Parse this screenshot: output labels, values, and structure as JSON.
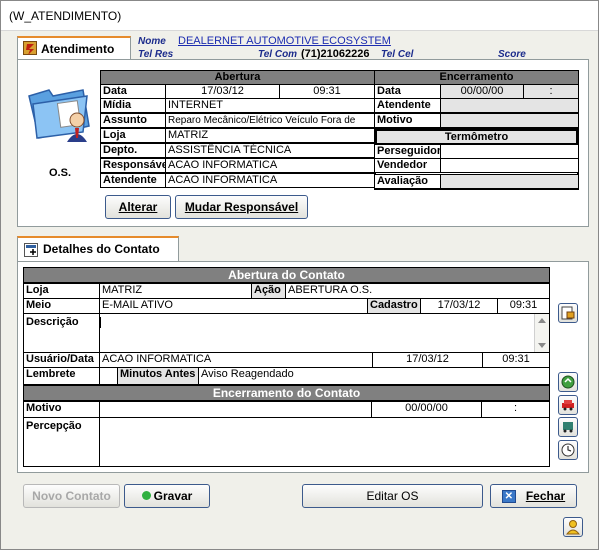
{
  "window": {
    "title": "(W_ATENDIMENTO)"
  },
  "atendimento_tab": {
    "label": "Atendimento"
  },
  "customer": {
    "nome_label": "Nome",
    "nome_value": "DEALERNET AUTOMOTIVE ECOSYSTEM",
    "telres_label": "Tel Res",
    "telcom_label": "Tel Com",
    "telcom_value": "(71)21062226",
    "telcel_label": "Tel Cel",
    "score_label": "Score"
  },
  "os_label": "O.S.",
  "abertura": {
    "header": "Abertura",
    "data_label": "Data",
    "data_date": "17/03/12",
    "data_time": "09:31",
    "midia_label": "Mídia",
    "midia_value": "INTERNET",
    "assunto_label": "Assunto",
    "assunto_value": "Reparo Mecânico/Elétrico Veículo Fora de",
    "loja_label": "Loja",
    "loja_value": "MATRIZ",
    "depto_label": "Depto.",
    "depto_value": "ASSISTÊNCIA TÉCNICA",
    "responsavel_label": "Responsável",
    "responsavel_value": "ACAO INFORMATICA",
    "atendente_label": "Atendente",
    "atendente_value": "ACAO INFORMATICA"
  },
  "encerramento": {
    "header": "Encerramento",
    "data_label": "Data",
    "data_date": "00/00/00",
    "data_time": ":",
    "atendente_label": "Atendente",
    "motivo_label": "Motivo"
  },
  "termometro": {
    "header": "Termômetro",
    "perseguidor_label": "Perseguidor",
    "vendedor_label": "Vendedor",
    "avaliacao_label": "Avaliação"
  },
  "buttons_top": {
    "alterar": "Alterar",
    "mudar": "Mudar Responsável"
  },
  "detalhes_tab": {
    "label": "Detalhes do Contato"
  },
  "abertura_contato": {
    "header": "Abertura do Contato",
    "loja_label": "Loja",
    "loja_value": "MATRIZ",
    "acao_label": "Ação",
    "acao_value": "ABERTURA O.S.",
    "meio_label": "Meio",
    "meio_value": "E-MAIL ATIVO",
    "cadastro_label": "Cadastro",
    "cadastro_date": "17/03/12",
    "cadastro_time": "09:31",
    "descricao_label": "Descrição",
    "usuario_label": "Usuário/Data",
    "usuario_value": "ACAO INFORMATICA",
    "usuario_date": "17/03/12",
    "usuario_time": "09:31",
    "lembrete_label": "Lembrete",
    "minutos_label": "Minutos Antes",
    "minutos_value": "Aviso Reagendado"
  },
  "encerramento_contato": {
    "header": "Encerramento do Contato",
    "motivo_label": "Motivo",
    "motivo_date": "00/00/00",
    "motivo_time": ":",
    "percepcao_label": "Percepção"
  },
  "buttons_bottom": {
    "novo": "Novo Contato",
    "gravar": "Gravar",
    "editar": "Editar OS",
    "fechar": "Fechar"
  }
}
